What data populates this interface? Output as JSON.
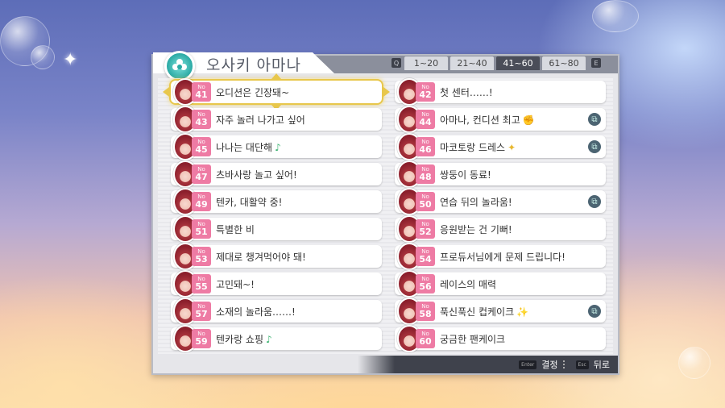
{
  "header": {
    "title": "오사키 아마나",
    "emblem_icon": "flower-emblem-icon",
    "prev_key": "Q",
    "next_key": "E",
    "tabs": [
      {
        "label": "1~20",
        "active": false
      },
      {
        "label": "21~40",
        "active": false
      },
      {
        "label": "41~60",
        "active": true
      },
      {
        "label": "61~80",
        "active": false
      }
    ]
  },
  "items": [
    {
      "no": "No",
      "num": "41",
      "label": "오디션은 긴장돼~",
      "selected": true,
      "clip": false,
      "emoji": ""
    },
    {
      "no": "No",
      "num": "42",
      "label": "첫 센터……!",
      "selected": false,
      "clip": false,
      "emoji": ""
    },
    {
      "no": "No",
      "num": "43",
      "label": "자주 놀러 나가고 싶어",
      "selected": false,
      "clip": false,
      "emoji": ""
    },
    {
      "no": "No",
      "num": "44",
      "label": "아마나, 컨디션 최고",
      "selected": false,
      "clip": true,
      "emoji": "✊"
    },
    {
      "no": "No",
      "num": "45",
      "label": "나나는 대단해",
      "selected": false,
      "clip": false,
      "emoji": "♪"
    },
    {
      "no": "No",
      "num": "46",
      "label": "마코토랑 드레스",
      "selected": false,
      "clip": true,
      "emoji": "✦"
    },
    {
      "no": "No",
      "num": "47",
      "label": "츠바사랑 놀고 싶어!",
      "selected": false,
      "clip": false,
      "emoji": ""
    },
    {
      "no": "No",
      "num": "48",
      "label": "쌍둥이 동료!",
      "selected": false,
      "clip": false,
      "emoji": ""
    },
    {
      "no": "No",
      "num": "49",
      "label": "텐카, 대활약 중!",
      "selected": false,
      "clip": false,
      "emoji": ""
    },
    {
      "no": "No",
      "num": "50",
      "label": "연습 뒤의 놀라움!",
      "selected": false,
      "clip": true,
      "emoji": ""
    },
    {
      "no": "No",
      "num": "51",
      "label": "특별한 비",
      "selected": false,
      "clip": false,
      "emoji": ""
    },
    {
      "no": "No",
      "num": "52",
      "label": "응원받는 건 기뻐!",
      "selected": false,
      "clip": false,
      "emoji": ""
    },
    {
      "no": "No",
      "num": "53",
      "label": "제대로 챙겨먹어야 돼!",
      "selected": false,
      "clip": false,
      "emoji": ""
    },
    {
      "no": "No",
      "num": "54",
      "label": "프로듀서님에게 문제 드립니다!",
      "selected": false,
      "clip": false,
      "emoji": ""
    },
    {
      "no": "No",
      "num": "55",
      "label": "고민돼~!",
      "selected": false,
      "clip": false,
      "emoji": ""
    },
    {
      "no": "No",
      "num": "56",
      "label": "레이스의 매력",
      "selected": false,
      "clip": false,
      "emoji": ""
    },
    {
      "no": "No",
      "num": "57",
      "label": "소재의 놀라움……!",
      "selected": false,
      "clip": false,
      "emoji": ""
    },
    {
      "no": "No",
      "num": "58",
      "label": "푹신푹신 컵케이크",
      "selected": false,
      "clip": true,
      "emoji": "✨"
    },
    {
      "no": "No",
      "num": "59",
      "label": "텐카랑 쇼핑",
      "selected": false,
      "clip": false,
      "emoji": "♪"
    },
    {
      "no": "No",
      "num": "60",
      "label": "궁금한 팬케이크",
      "selected": false,
      "clip": false,
      "emoji": ""
    }
  ],
  "footer": {
    "confirm_key": "Enter",
    "confirm_label": "결정",
    "back_key": "Esc",
    "back_label": "뒤로"
  },
  "colors": {
    "badge_pink": "#ee7ba4",
    "active_tab": "#4a4d58",
    "selection_gold": "#e8c74c",
    "clip_icon": "#4c6472"
  }
}
